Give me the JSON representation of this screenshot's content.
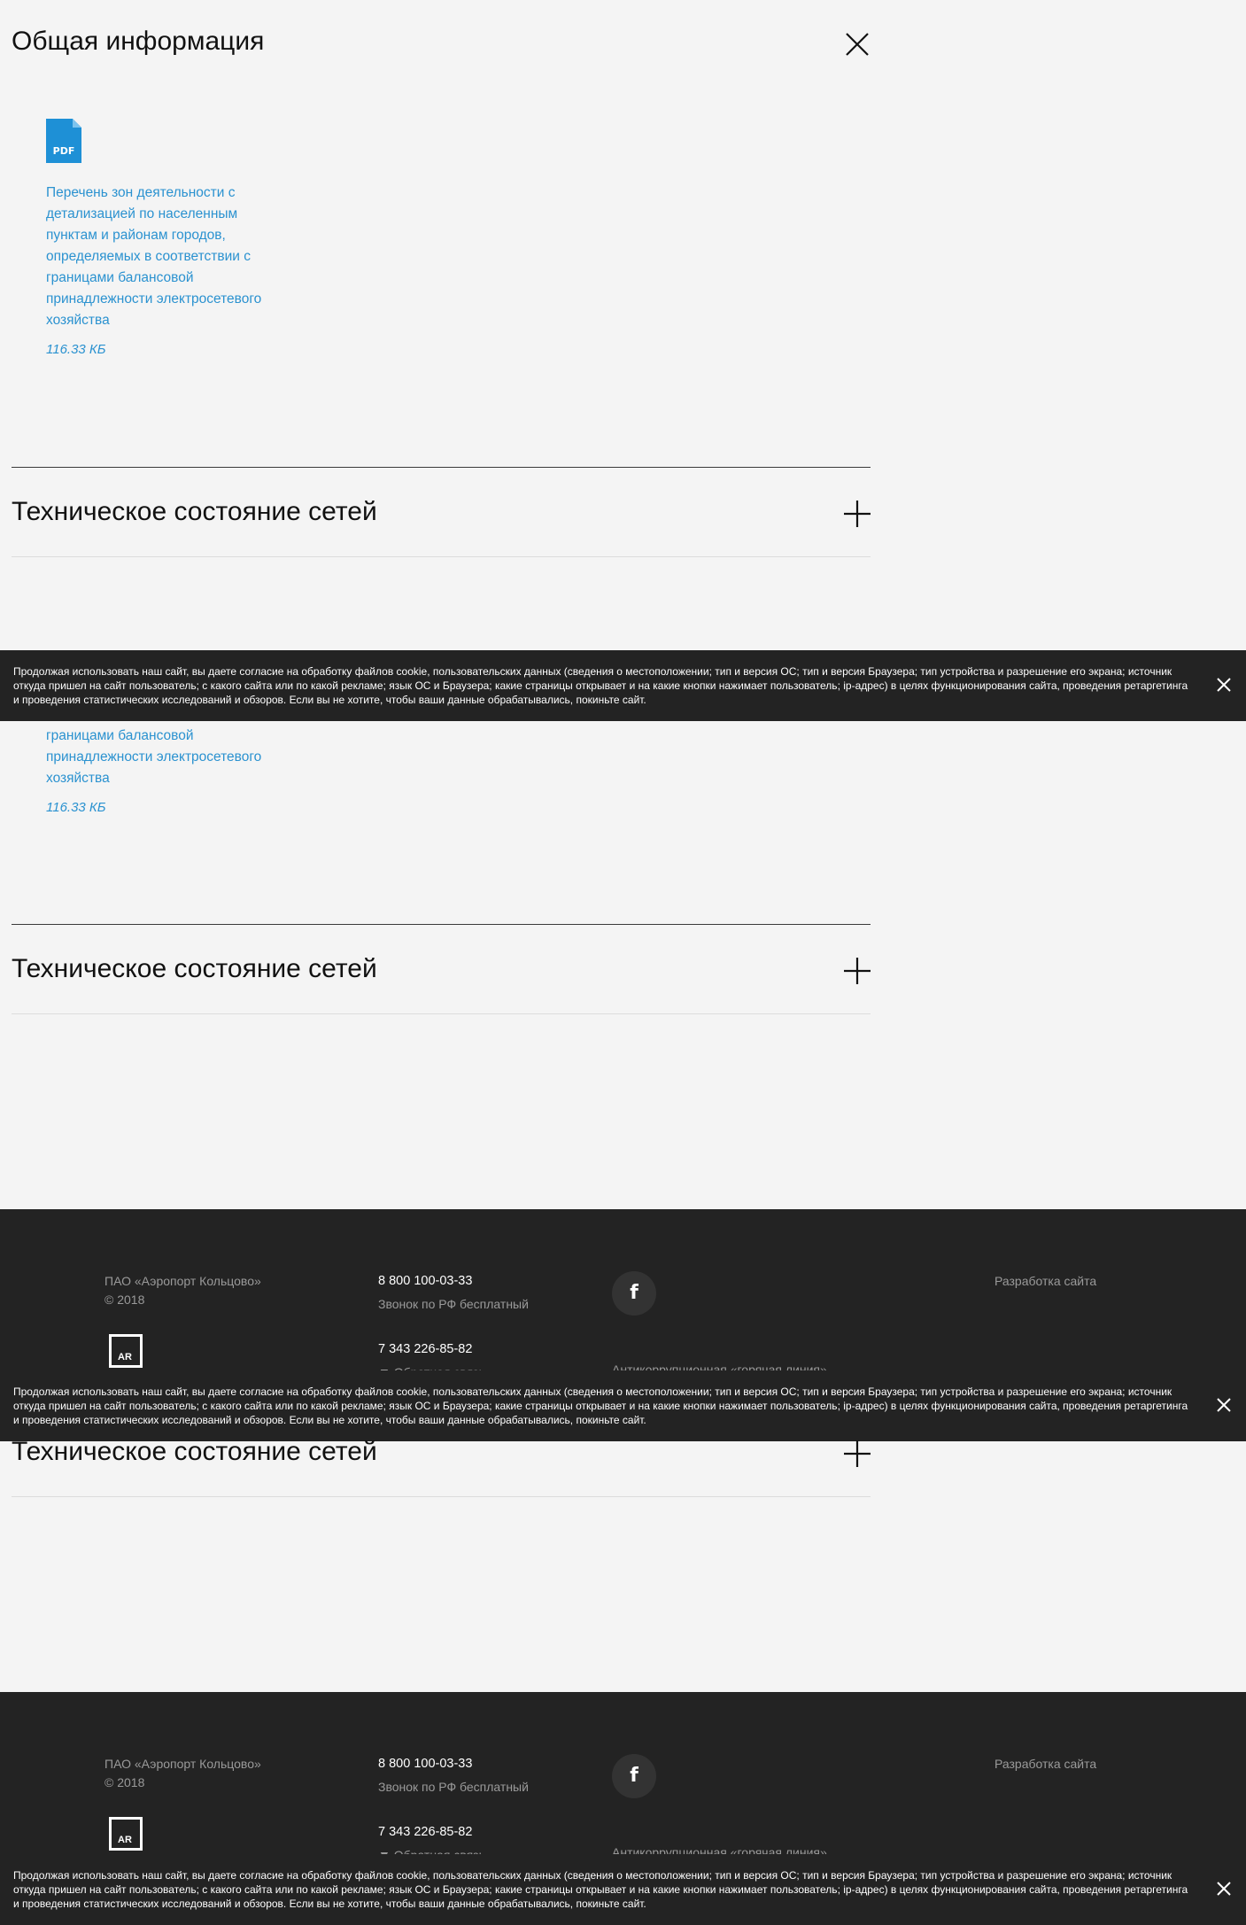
{
  "general_section": {
    "title": "Общая информация"
  },
  "document": {
    "file_type": "PDF",
    "title": "Перечень зон деятельности с детализацией по населенным пунктам и районам городов, определяемых в соответствии с границами балансовой принадлежности электросетевого хозяйства",
    "title_tail": "границами балансовой принадлежности электросетевого хозяйства",
    "size": "116.33 КБ"
  },
  "tech_section": {
    "title": "Техническое состояние сетей"
  },
  "cookie_notice": {
    "text": "Продолжая использовать наш сайт, вы даете согласие на обработку файлов cookie, пользовательских данных (сведения о местоположении; тип и версия ОС; тип и версия Браузера; тип устройства и разрешение его экрана; источник откуда пришел на сайт пользователь; с какого сайта или по какой рекламе; язык ОС и Браузера; какие страницы открывает и на какие кнопки нажимает пользователь; ip-адрес) в целях функционирования сайта, проведения ретаргетинга и проведения статистических исследований и обзоров. Если вы не хотите, чтобы ваши данные обрабатывались, покиньте сайт."
  },
  "footer": {
    "company": "ПАО «Аэропорт Кольцово»",
    "year": "© 2018",
    "logo_text": "AR",
    "phone_1": "8 800 100-03-33",
    "phone_1_note": "Звонок по РФ бесплатный",
    "phone_2": "7 343 226-85-82",
    "phone_2_note": "Обратная связь",
    "social_icon": "f",
    "anticorruption": "Антикоррупционная «горячая линия»",
    "dev_link": "Разработка сайта"
  },
  "colors": {
    "link": "#2b92d0",
    "pdf_icon": "#1e90d6",
    "dark": "#232323",
    "page_bg": "#f4f4f4"
  }
}
